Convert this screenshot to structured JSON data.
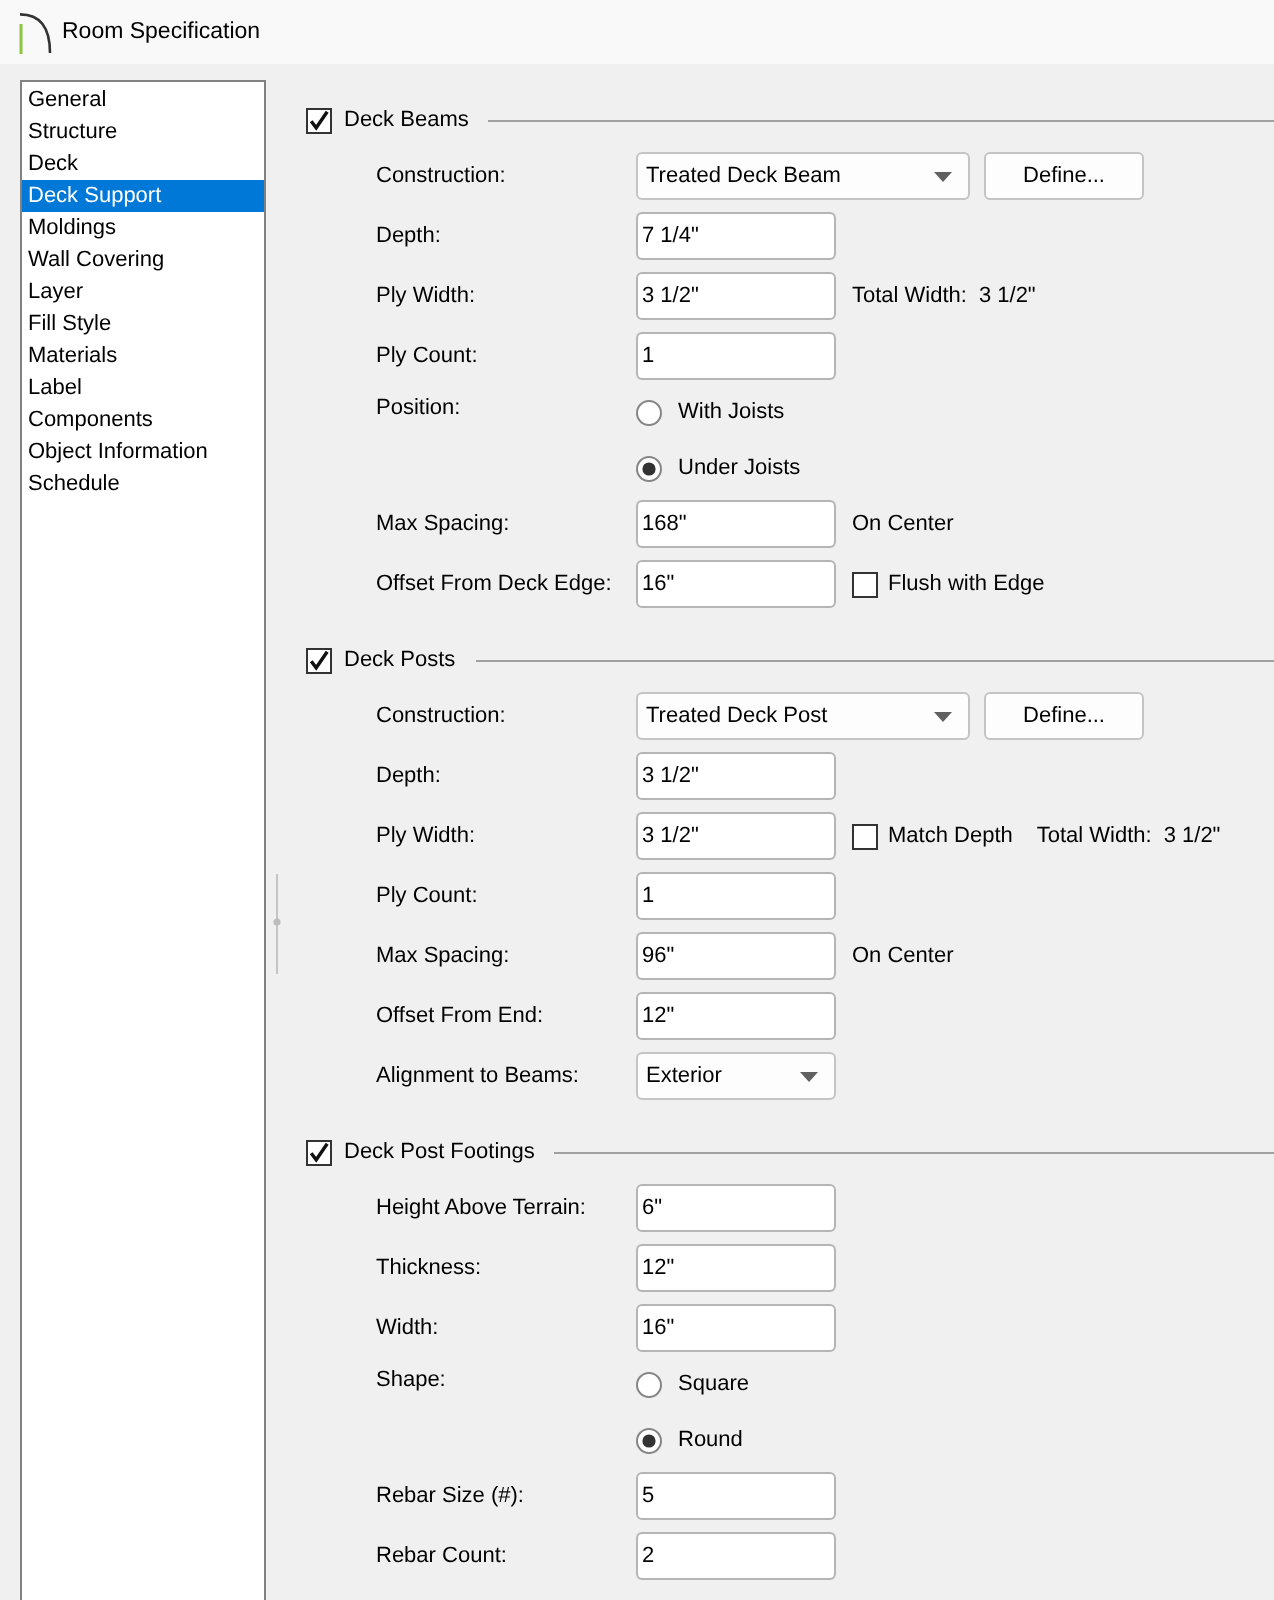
{
  "window": {
    "title": "Room Specification"
  },
  "sidebar": {
    "items": [
      {
        "label": "General",
        "selected": false
      },
      {
        "label": "Structure",
        "selected": false
      },
      {
        "label": "Deck",
        "selected": false
      },
      {
        "label": "Deck Support",
        "selected": true
      },
      {
        "label": "Moldings",
        "selected": false
      },
      {
        "label": "Wall Covering",
        "selected": false
      },
      {
        "label": "Layer",
        "selected": false
      },
      {
        "label": "Fill Style",
        "selected": false
      },
      {
        "label": "Materials",
        "selected": false
      },
      {
        "label": "Label",
        "selected": false
      },
      {
        "label": "Components",
        "selected": false
      },
      {
        "label": "Object Information",
        "selected": false
      },
      {
        "label": "Schedule",
        "selected": false
      }
    ]
  },
  "sections": [
    {
      "title": "Deck Beams",
      "checked": true,
      "rows": [
        {
          "kind": "dropdown",
          "label": "Construction:",
          "value": "Treated Deck Beam",
          "button": "Define..."
        },
        {
          "kind": "field",
          "label": "Depth:",
          "value": "7 1/4\""
        },
        {
          "kind": "field",
          "label": "Ply Width:",
          "value": "3 1/2\"",
          "notes": [
            "Total Width:",
            "3 1/2\""
          ]
        },
        {
          "kind": "field",
          "label": "Ply Count:",
          "value": "1"
        },
        {
          "kind": "radio",
          "label": "Position:",
          "options": [
            {
              "label": "With Joists",
              "selected": false
            },
            {
              "label": "Under Joists",
              "selected": true
            }
          ]
        },
        {
          "kind": "field",
          "label": "Max Spacing:",
          "value": "168\"",
          "notes": [
            "On Center"
          ]
        },
        {
          "kind": "field",
          "label": "Offset From Deck Edge:",
          "value": "16\"",
          "checkbox": {
            "label": "Flush with Edge",
            "checked": false
          }
        }
      ]
    },
    {
      "title": "Deck Posts",
      "checked": true,
      "rows": [
        {
          "kind": "dropdown",
          "label": "Construction:",
          "value": "Treated Deck Post",
          "button": "Define..."
        },
        {
          "kind": "field",
          "label": "Depth:",
          "value": "3 1/2\""
        },
        {
          "kind": "field",
          "label": "Ply Width:",
          "value": "3 1/2\"",
          "checkbox": {
            "label": "Match Depth",
            "checked": false
          },
          "notes": [
            "Total Width:",
            "3 1/2\""
          ]
        },
        {
          "kind": "field",
          "label": "Ply Count:",
          "value": "1"
        },
        {
          "kind": "field",
          "label": "Max Spacing:",
          "value": "96\"",
          "notes": [
            "On Center"
          ]
        },
        {
          "kind": "field",
          "label": "Offset From End:",
          "value": "12\""
        },
        {
          "kind": "dropdown",
          "label": "Alignment to Beams:",
          "value": "Exterior"
        }
      ]
    },
    {
      "title": "Deck Post Footings",
      "checked": true,
      "rows": [
        {
          "kind": "field",
          "label": "Height Above Terrain:",
          "value": "6\""
        },
        {
          "kind": "field",
          "label": "Thickness:",
          "value": "12\""
        },
        {
          "kind": "field",
          "label": "Width:",
          "value": "16\""
        },
        {
          "kind": "radio",
          "label": "Shape:",
          "options": [
            {
              "label": "Square",
              "selected": false
            },
            {
              "label": "Round",
              "selected": true
            }
          ]
        },
        {
          "kind": "field",
          "label": "Rebar Size (#):",
          "value": "5"
        },
        {
          "kind": "field",
          "label": "Rebar Count:",
          "value": "2"
        }
      ]
    }
  ]
}
